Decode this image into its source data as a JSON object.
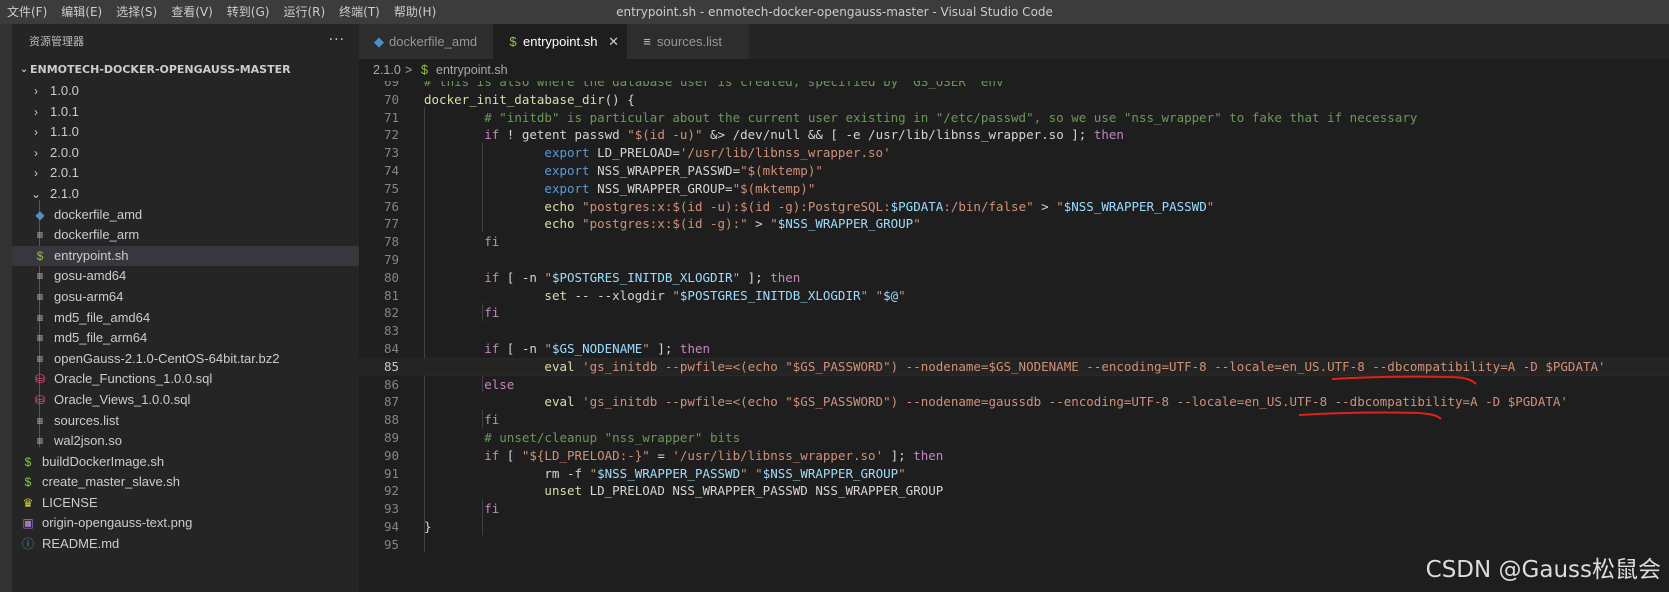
{
  "menu": [
    "文件(F)",
    "编辑(E)",
    "选择(S)",
    "查看(V)",
    "转到(G)",
    "运行(R)",
    "终端(T)",
    "帮助(H)"
  ],
  "window_title": "entrypoint.sh - enmotech-docker-opengauss-master - Visual Studio Code",
  "explorer": {
    "title": "资源管理器",
    "more": "···",
    "root": "ENMOTECH-DOCKER-OPENGAUSS-MASTER",
    "items": [
      {
        "label": "1.0.0",
        "icon": "chevron-right-icon",
        "glyph": "›",
        "color": "#cccccc"
      },
      {
        "label": "1.0.1",
        "icon": "chevron-right-icon",
        "glyph": "›",
        "color": "#cccccc"
      },
      {
        "label": "1.1.0",
        "icon": "chevron-right-icon",
        "glyph": "›",
        "color": "#cccccc"
      },
      {
        "label": "2.0.0",
        "icon": "chevron-right-icon",
        "glyph": "›",
        "color": "#cccccc"
      },
      {
        "label": "2.0.1",
        "icon": "chevron-right-icon",
        "glyph": "›",
        "color": "#cccccc"
      },
      {
        "label": "2.1.0",
        "icon": "chevron-down-icon",
        "glyph": "⌄",
        "color": "#cccccc"
      },
      {
        "label": "dockerfile_amd",
        "icon": "docker-icon",
        "glyph": "◆",
        "color": "#4f90c8"
      },
      {
        "label": "dockerfile_arm",
        "icon": "file-lines-icon",
        "glyph": "≡",
        "color": "#c5c5c5"
      },
      {
        "label": "entrypoint.sh",
        "icon": "shell-dollar-icon",
        "glyph": "$",
        "color": "#8dc149"
      },
      {
        "label": "gosu-amd64",
        "icon": "file-lines-icon",
        "glyph": "≡",
        "color": "#c5c5c5"
      },
      {
        "label": "gosu-arm64",
        "icon": "file-lines-icon",
        "glyph": "≡",
        "color": "#c5c5c5"
      },
      {
        "label": "md5_file_amd64",
        "icon": "file-lines-icon",
        "glyph": "≡",
        "color": "#c5c5c5"
      },
      {
        "label": "md5_file_arm64",
        "icon": "file-lines-icon",
        "glyph": "≡",
        "color": "#c5c5c5"
      },
      {
        "label": "openGauss-2.1.0-CentOS-64bit.tar.bz2",
        "icon": "file-lines-icon",
        "glyph": "≡",
        "color": "#c5c5c5"
      },
      {
        "label": "Oracle_Functions_1.0.0.sql",
        "icon": "database-icon",
        "glyph": "⛁",
        "color": "#f55385"
      },
      {
        "label": "Oracle_Views_1.0.0.sql",
        "icon": "database-icon",
        "glyph": "⛁",
        "color": "#f55385"
      },
      {
        "label": "sources.list",
        "icon": "file-lines-icon",
        "glyph": "≡",
        "color": "#c5c5c5"
      },
      {
        "label": "wal2json.so",
        "icon": "file-lines-icon",
        "glyph": "≡",
        "color": "#c5c5c5"
      },
      {
        "label": "buildDockerImage.sh",
        "icon": "shell-dollar-icon",
        "glyph": "$",
        "color": "#8dc149"
      },
      {
        "label": "create_master_slave.sh",
        "icon": "shell-dollar-icon",
        "glyph": "$",
        "color": "#8dc149"
      },
      {
        "label": "LICENSE",
        "icon": "license-icon",
        "glyph": "♛",
        "color": "#cbcb41"
      },
      {
        "label": "origin-opengauss-text.png",
        "icon": "image-icon",
        "glyph": "▣",
        "color": "#a074c4"
      },
      {
        "label": "README.md",
        "icon": "info-icon",
        "glyph": "ⓘ",
        "color": "#519aba"
      }
    ]
  },
  "tabs": [
    {
      "label": "dockerfile_amd",
      "icon": "docker-icon",
      "glyph": "◆",
      "color": "#4f90c8"
    },
    {
      "label": "entrypoint.sh",
      "icon": "shell-dollar-icon",
      "glyph": "$",
      "color": "#8dc149",
      "close": "✕"
    },
    {
      "label": "sources.list",
      "icon": "file-lines-icon",
      "glyph": "≡",
      "color": "#c5c5c5"
    }
  ],
  "breadcrumb": {
    "folder": "2.1.0",
    "separator": ">",
    "icon_glyph": "$",
    "file": "entrypoint.sh"
  },
  "code": {
    "current_line": 85,
    "lines": [
      {
        "n": 69,
        "tokens": [
          [
            "c",
            "# this is also where the database user is created, specified by `GS_USER` env"
          ]
        ]
      },
      {
        "n": 70,
        "tokens": [
          [
            "f",
            "docker_init_database_dir"
          ],
          [
            "p",
            "() {"
          ]
        ]
      },
      {
        "n": 71,
        "tokens": [
          [
            "p",
            "        "
          ],
          [
            "c",
            "# \"initdb\" is particular about the current user existing in \"/etc/passwd\", so we use \"nss_wrapper\" to fake that if necessary"
          ]
        ]
      },
      {
        "n": 72,
        "tokens": [
          [
            "p",
            "        "
          ],
          [
            "k",
            "if"
          ],
          [
            "p",
            " ! getent passwd "
          ],
          [
            "s",
            "\"$(id -u)\""
          ],
          [
            "p",
            " &> /dev/null && [ -e /usr/lib/libnss_wrapper.so ]; "
          ],
          [
            "k",
            "then"
          ]
        ]
      },
      {
        "n": 73,
        "tokens": [
          [
            "p",
            "                "
          ],
          [
            "b",
            "export"
          ],
          [
            "p",
            " LD_PRELOAD="
          ],
          [
            "s",
            "'/usr/lib/libnss_wrapper.so'"
          ]
        ]
      },
      {
        "n": 74,
        "tokens": [
          [
            "p",
            "                "
          ],
          [
            "b",
            "export"
          ],
          [
            "p",
            " NSS_WRAPPER_PASSWD="
          ],
          [
            "s",
            "\"$(mktemp)\""
          ]
        ]
      },
      {
        "n": 75,
        "tokens": [
          [
            "p",
            "                "
          ],
          [
            "b",
            "export"
          ],
          [
            "p",
            " NSS_WRAPPER_GROUP="
          ],
          [
            "s",
            "\"$(mktemp)\""
          ]
        ]
      },
      {
        "n": 76,
        "tokens": [
          [
            "p",
            "                "
          ],
          [
            "f",
            "echo"
          ],
          [
            "p",
            " "
          ],
          [
            "s",
            "\"postgres:x:$(id -u):$(id -g):PostgreSQL:"
          ],
          [
            "v",
            "$PGDATA"
          ],
          [
            "s",
            ":/bin/false\""
          ],
          [
            "p",
            " > "
          ],
          [
            "s",
            "\""
          ],
          [
            "v",
            "$NSS_WRAPPER_PASSWD"
          ],
          [
            "s",
            "\""
          ]
        ]
      },
      {
        "n": 77,
        "tokens": [
          [
            "p",
            "                "
          ],
          [
            "f",
            "echo"
          ],
          [
            "p",
            " "
          ],
          [
            "s",
            "\"postgres:x:$(id -g):\""
          ],
          [
            "p",
            " > "
          ],
          [
            "s",
            "\""
          ],
          [
            "v",
            "$NSS_WRAPPER_GROUP"
          ],
          [
            "s",
            "\""
          ]
        ]
      },
      {
        "n": 78,
        "tokens": [
          [
            "p",
            "        "
          ],
          [
            "k",
            "fi"
          ]
        ]
      },
      {
        "n": 79,
        "tokens": []
      },
      {
        "n": 80,
        "tokens": [
          [
            "p",
            "        "
          ],
          [
            "k",
            "if"
          ],
          [
            "p",
            " [ -n "
          ],
          [
            "s",
            "\""
          ],
          [
            "v",
            "$POSTGRES_INITDB_XLOGDIR"
          ],
          [
            "s",
            "\""
          ],
          [
            "p",
            " ]; "
          ],
          [
            "k",
            "then"
          ]
        ]
      },
      {
        "n": 81,
        "tokens": [
          [
            "p",
            "                "
          ],
          [
            "f",
            "set"
          ],
          [
            "p",
            " -- --xlogdir "
          ],
          [
            "s",
            "\""
          ],
          [
            "v",
            "$POSTGRES_INITDB_XLOGDIR"
          ],
          [
            "s",
            "\""
          ],
          [
            "p",
            " "
          ],
          [
            "s",
            "\""
          ],
          [
            "v",
            "$@"
          ],
          [
            "s",
            "\""
          ]
        ]
      },
      {
        "n": 82,
        "tokens": [
          [
            "p",
            "        "
          ],
          [
            "k",
            "fi"
          ]
        ]
      },
      {
        "n": 83,
        "tokens": []
      },
      {
        "n": 84,
        "tokens": [
          [
            "p",
            "        "
          ],
          [
            "k",
            "if"
          ],
          [
            "p",
            " [ -n "
          ],
          [
            "s",
            "\""
          ],
          [
            "v",
            "$GS_NODENAME"
          ],
          [
            "s",
            "\""
          ],
          [
            "p",
            " ]; "
          ],
          [
            "k",
            "then"
          ]
        ]
      },
      {
        "n": 85,
        "tokens": [
          [
            "p",
            "                "
          ],
          [
            "f",
            "eval"
          ],
          [
            "p",
            " "
          ],
          [
            "s",
            "'gs_initdb --pwfile=<(echo \"$GS_PASSWORD\") --nodename=$GS_NODENAME --encoding=UTF-8 --locale=en_US.UTF-8 --dbcompatibility=A -D $PGDATA'"
          ]
        ]
      },
      {
        "n": 86,
        "tokens": [
          [
            "p",
            "        "
          ],
          [
            "k",
            "else"
          ]
        ]
      },
      {
        "n": 87,
        "tokens": [
          [
            "p",
            "                "
          ],
          [
            "f",
            "eval"
          ],
          [
            "p",
            " "
          ],
          [
            "s",
            "'gs_initdb --pwfile=<(echo \"$GS_PASSWORD\") --nodename=gaussdb --encoding=UTF-8 --locale=en_US.UTF-8 --dbcompatibility=A -D $PGDATA'"
          ]
        ]
      },
      {
        "n": 88,
        "tokens": [
          [
            "p",
            "        "
          ],
          [
            "k",
            "fi"
          ]
        ]
      },
      {
        "n": 89,
        "tokens": [
          [
            "p",
            "        "
          ],
          [
            "c",
            "# unset/cleanup \"nss_wrapper\" bits"
          ]
        ]
      },
      {
        "n": 90,
        "tokens": [
          [
            "p",
            "        "
          ],
          [
            "k",
            "if"
          ],
          [
            "p",
            " [ "
          ],
          [
            "s",
            "\"${LD_PRELOAD:-}\""
          ],
          [
            "p",
            " = "
          ],
          [
            "s",
            "'/usr/lib/libnss_wrapper.so'"
          ],
          [
            "p",
            " ]; "
          ],
          [
            "k",
            "then"
          ]
        ]
      },
      {
        "n": 91,
        "tokens": [
          [
            "p",
            "                rm -f "
          ],
          [
            "s",
            "\""
          ],
          [
            "v",
            "$NSS_WRAPPER_PASSWD"
          ],
          [
            "s",
            "\""
          ],
          [
            "p",
            " "
          ],
          [
            "s",
            "\""
          ],
          [
            "v",
            "$NSS_WRAPPER_GROUP"
          ],
          [
            "s",
            "\""
          ]
        ]
      },
      {
        "n": 92,
        "tokens": [
          [
            "p",
            "                "
          ],
          [
            "f",
            "unset"
          ],
          [
            "p",
            " LD_PRELOAD NSS_WRAPPER_PASSWD NSS_WRAPPER_GROUP"
          ]
        ]
      },
      {
        "n": 93,
        "tokens": [
          [
            "p",
            "        "
          ],
          [
            "k",
            "fi"
          ]
        ]
      },
      {
        "n": 94,
        "tokens": [
          [
            "p",
            "}"
          ]
        ]
      },
      {
        "n": 95,
        "tokens": []
      }
    ]
  },
  "watermark": "CSDN @Gauss松鼠会",
  "colors": {
    "annotation_underline": "#e0201b"
  }
}
